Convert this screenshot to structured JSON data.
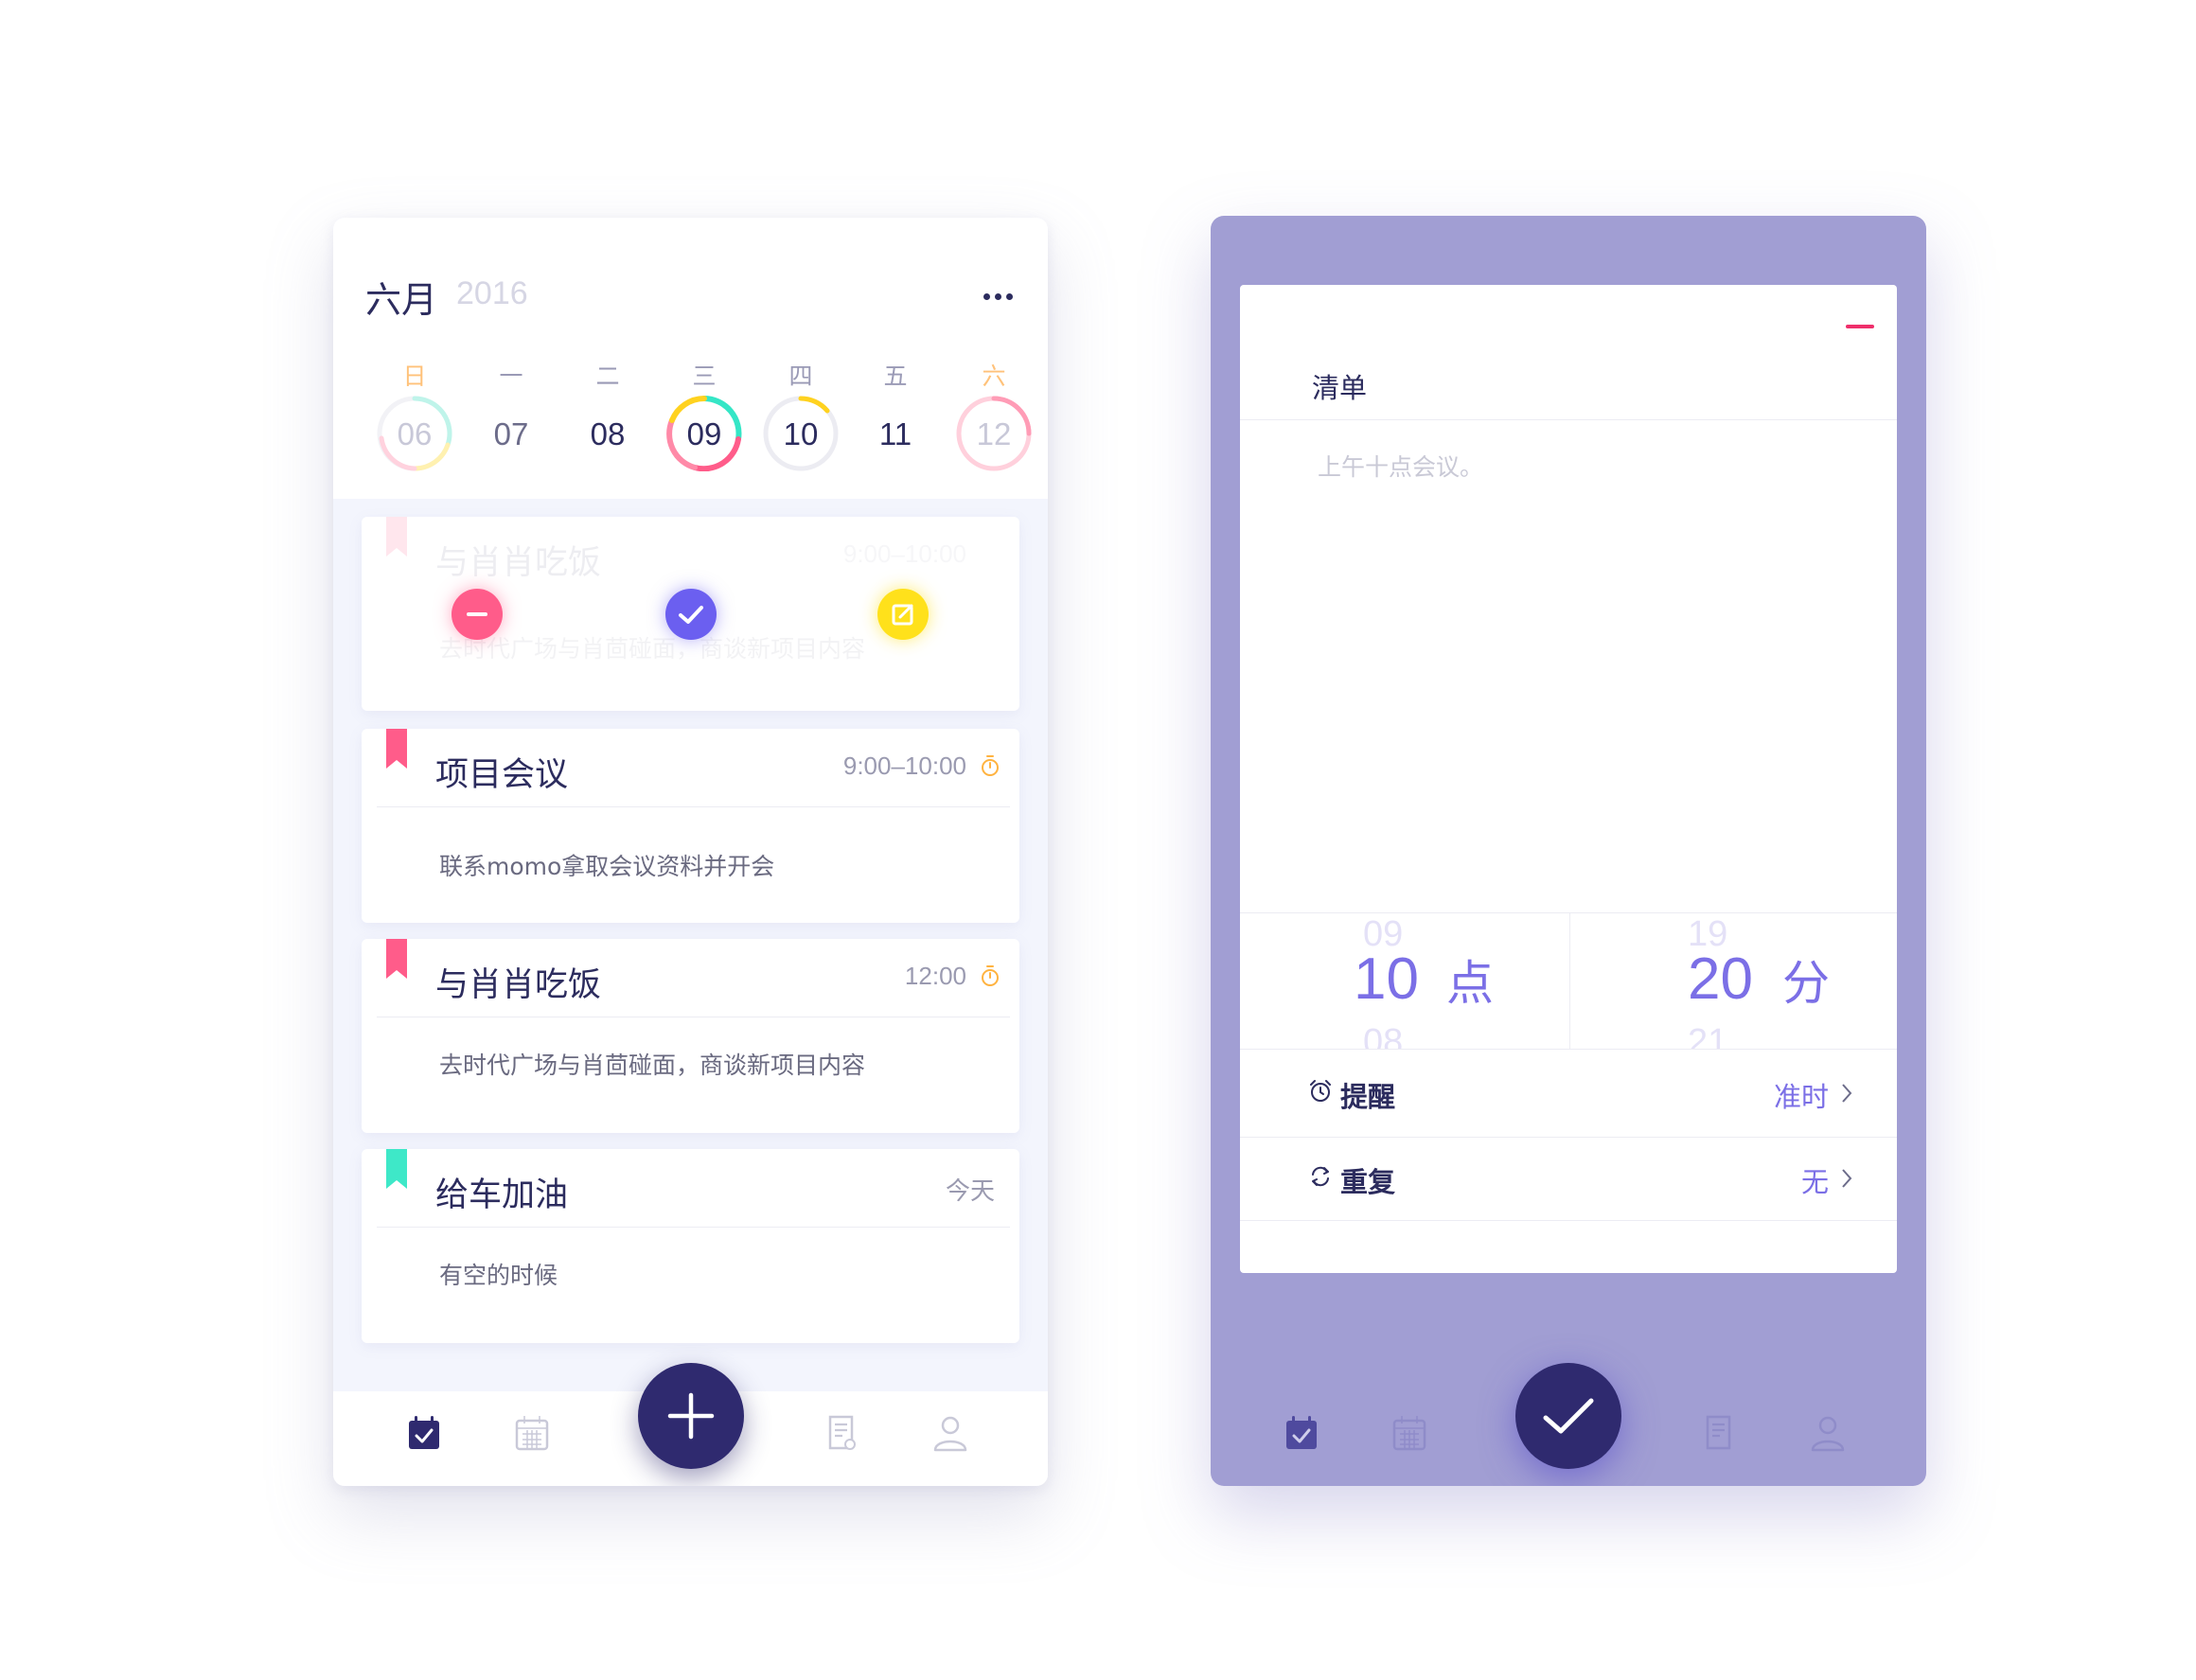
{
  "calendar": {
    "month": "六月",
    "year": "2016",
    "days": [
      {
        "weekday": "日",
        "date": "06"
      },
      {
        "weekday": "一",
        "date": "07"
      },
      {
        "weekday": "二",
        "date": "08"
      },
      {
        "weekday": "三",
        "date": "09"
      },
      {
        "weekday": "四",
        "date": "10"
      },
      {
        "weekday": "五",
        "date": "11"
      },
      {
        "weekday": "六",
        "date": "12"
      }
    ]
  },
  "tasks": [
    {
      "title": "与肖肖吃饭",
      "time": "9:00–10:00",
      "desc": "去时代广场与肖茴碰面，商谈新项目内容"
    },
    {
      "title": "项目会议",
      "time": "9:00–10:00",
      "desc": "联系momo拿取会议资料并开会"
    },
    {
      "title": "与肖肖吃饭",
      "time": "12:00",
      "desc": "去时代广场与肖茴碰面，商谈新项目内容"
    },
    {
      "title": "给车加油",
      "time": "今天",
      "desc": "有空的时候"
    }
  ],
  "editor": {
    "title": "清单",
    "note_placeholder": "上午十点会议。",
    "hour": {
      "prev": "09",
      "current": "10",
      "next": "08",
      "unit": "点"
    },
    "minute": {
      "prev": "19",
      "current": "20",
      "next": "21",
      "unit": "分"
    },
    "reminder": {
      "label": "提醒",
      "value": "准时"
    },
    "repeat": {
      "label": "重复",
      "value": "无"
    }
  },
  "colors": {
    "primary": "#2f2a6f",
    "accent": "#7b6fe6",
    "panel": "#a19ed3",
    "pink": "#ff5c8a",
    "teal": "#3ee8c8",
    "yellow": "#ffe11b",
    "orange": "#ffb340"
  },
  "icons": {
    "tabs": [
      "calendar-check-icon",
      "calendar-grid-icon",
      "add-icon",
      "notes-icon",
      "profile-icon"
    ],
    "actions": [
      "delete-icon",
      "complete-icon",
      "edit-icon"
    ]
  }
}
